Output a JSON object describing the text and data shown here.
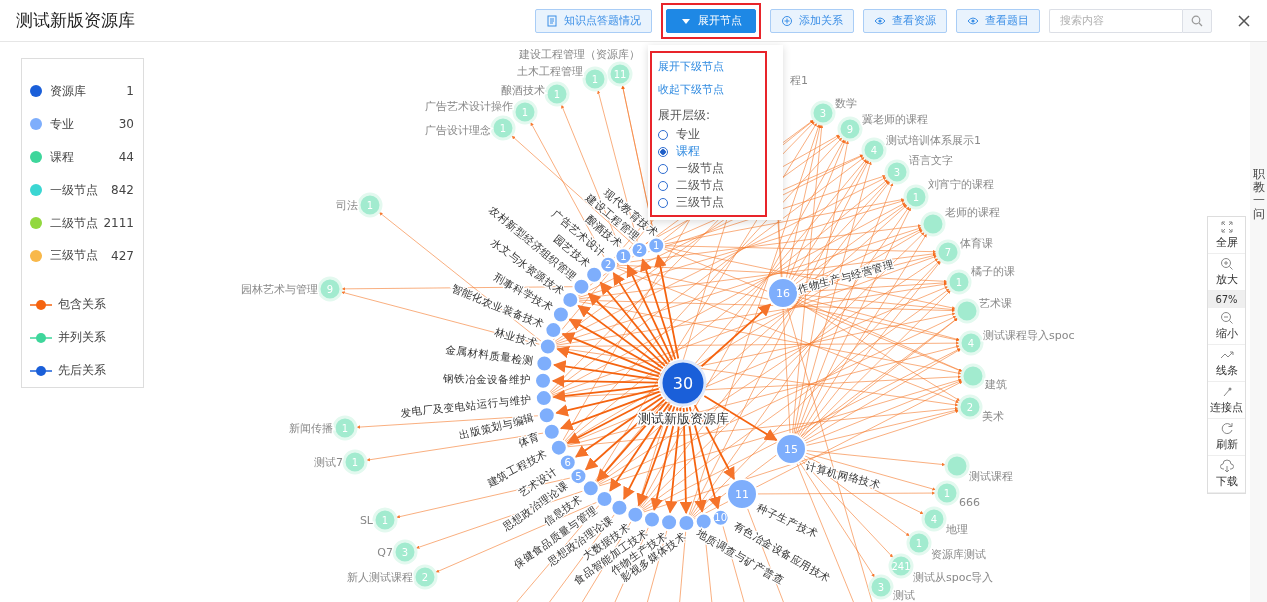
{
  "window": {
    "title": "测试新版资源库"
  },
  "toolbar": {
    "buttons": [
      {
        "label": "知识点答题情况",
        "kind": "default",
        "highlighted": false
      },
      {
        "label": "展开节点",
        "kind": "primary",
        "highlighted": true
      },
      {
        "label": "添加关系",
        "kind": "default",
        "highlighted": false
      },
      {
        "label": "查看资源",
        "kind": "default",
        "highlighted": false
      },
      {
        "label": "查看题目",
        "kind": "default",
        "highlighted": false
      }
    ],
    "search": {
      "placeholder": "搜索内容"
    }
  },
  "legend": {
    "items": [
      {
        "label": "资源库",
        "count": "1",
        "color": "#1a5fd9"
      },
      {
        "label": "专业",
        "count": "30",
        "color": "#7eaefc"
      },
      {
        "label": "课程",
        "count": "44",
        "color": "#3ed69b"
      },
      {
        "label": "一级节点",
        "count": "842",
        "color": "#3bd6d2"
      },
      {
        "label": "二级节点",
        "count": "2111",
        "color": "#92d83e"
      },
      {
        "label": "三级节点",
        "count": "427",
        "color": "#f8b84a"
      }
    ],
    "relations": [
      {
        "label": "包含关系",
        "color": "#f5630f"
      },
      {
        "label": "并列关系",
        "color": "#3ed69b"
      },
      {
        "label": "先后关系",
        "color": "#1a5fd9"
      }
    ]
  },
  "dropdown": {
    "highlighted": true,
    "actions": [
      "展开下级节点",
      "收起下级节点"
    ],
    "level_label": "展开层级:",
    "levels": [
      {
        "label": "专业",
        "selected": false
      },
      {
        "label": "课程",
        "selected": true
      },
      {
        "label": "一级节点",
        "selected": false
      },
      {
        "label": "二级节点",
        "selected": false
      },
      {
        "label": "三级节点",
        "selected": false
      }
    ]
  },
  "graph": {
    "center": {
      "count": "30",
      "label": "测试新版资源库"
    },
    "majors": [
      {
        "label": "现代教育技术",
        "count": "1"
      },
      {
        "label": "建设工程管理",
        "count": "2"
      },
      {
        "label": "酿酒技术",
        "count": "1"
      },
      {
        "label": "广告艺术设计",
        "count": "2"
      },
      {
        "label": "园艺技术"
      },
      {
        "label": "农村新型经济组织管理"
      },
      {
        "label": "水文与水资源技术"
      },
      {
        "label": "刑事科学技术"
      },
      {
        "label": "智能化农业装备技术"
      },
      {
        "label": "林业技术"
      },
      {
        "label": "金属材料质量检测"
      },
      {
        "label": "钢铁冶金设备维护"
      },
      {
        "label": "发电厂及变电站运行与维护"
      },
      {
        "label": "出版策划与编辑"
      },
      {
        "label": "体育"
      },
      {
        "label": "建筑工程技术"
      },
      {
        "label": "艺术设计",
        "count": "6"
      },
      {
        "label": "思想政治理论课",
        "count": "5"
      },
      {
        "label": "信息技术"
      },
      {
        "label": "保健食品质量与管理"
      },
      {
        "label": "思想政治理论课"
      },
      {
        "label": "大数据技术"
      },
      {
        "label": "食品智能加工技术"
      },
      {
        "label": "作物生产技术"
      },
      {
        "label": "影视多媒体技术"
      },
      {
        "label": "地质调查与矿产普查"
      },
      {
        "label": "有色冶金设备应用技术",
        "count": "10"
      },
      {
        "label": "种子生产技术",
        "count": "11"
      },
      {
        "label": "计算机网络技术",
        "count": "15"
      },
      {
        "label": "作物生产与经营管理",
        "count": "16"
      }
    ],
    "top_courses": [
      {
        "label": "建设工程管理（资源库）",
        "count": "11"
      },
      {
        "label": "土木工程管理",
        "count": "1"
      },
      {
        "label": "酿酒技术",
        "count": "1"
      },
      {
        "label": "广告艺术设计操作",
        "count": "1"
      },
      {
        "label": "广告设计理念",
        "count": "1"
      }
    ],
    "right_courses": [
      {
        "label": "程1"
      },
      {
        "label": "数学",
        "count": "3"
      },
      {
        "label": "冀老师的课程",
        "count": "9"
      },
      {
        "label": "测试培训体系展示1",
        "count": "4"
      },
      {
        "label": "语言文字",
        "count": "3"
      },
      {
        "label": "刘宵宁的课程",
        "count": "1"
      },
      {
        "label": "老师的课程"
      },
      {
        "label": "体育课",
        "count": "7"
      },
      {
        "label": "橘子的课",
        "count": "1"
      },
      {
        "label": "艺术课"
      },
      {
        "label": "测试课程导入spoc",
        "count": "4"
      },
      {
        "label": "建筑"
      },
      {
        "label": "美术",
        "count": "2"
      },
      {
        "label": "测试课程"
      },
      {
        "label": "666",
        "count": "1"
      },
      {
        "label": "地理",
        "count": "4"
      },
      {
        "label": "资源库测试",
        "count": "1"
      },
      {
        "label": "测试从spoc导入",
        "count": "241"
      },
      {
        "label": "测试",
        "count": "3"
      }
    ],
    "left_courses": [
      {
        "label": "司法",
        "count": "1"
      },
      {
        "label": "园林艺术与管理",
        "count": "9"
      },
      {
        "label": "新闻传播",
        "count": "1"
      },
      {
        "label": "测试7",
        "count": "1"
      },
      {
        "label": "SL",
        "count": "1"
      },
      {
        "label": "Q7",
        "count": "3"
      },
      {
        "label": "新人测试课程",
        "count": "2"
      }
    ]
  },
  "zoom_controls": [
    {
      "kind": "fullscreen",
      "label": "全屏"
    },
    {
      "kind": "zoom_in",
      "label": "放大"
    },
    {
      "kind": "reading",
      "label": "67%"
    },
    {
      "kind": "zoom_out",
      "label": "缩小"
    },
    {
      "kind": "lines",
      "label": "线条"
    },
    {
      "kind": "points",
      "label": "连接点"
    },
    {
      "kind": "refresh",
      "label": "刷新"
    },
    {
      "kind": "download",
      "label": "下载"
    }
  ],
  "side_tab": {
    "label": "职教一问"
  }
}
